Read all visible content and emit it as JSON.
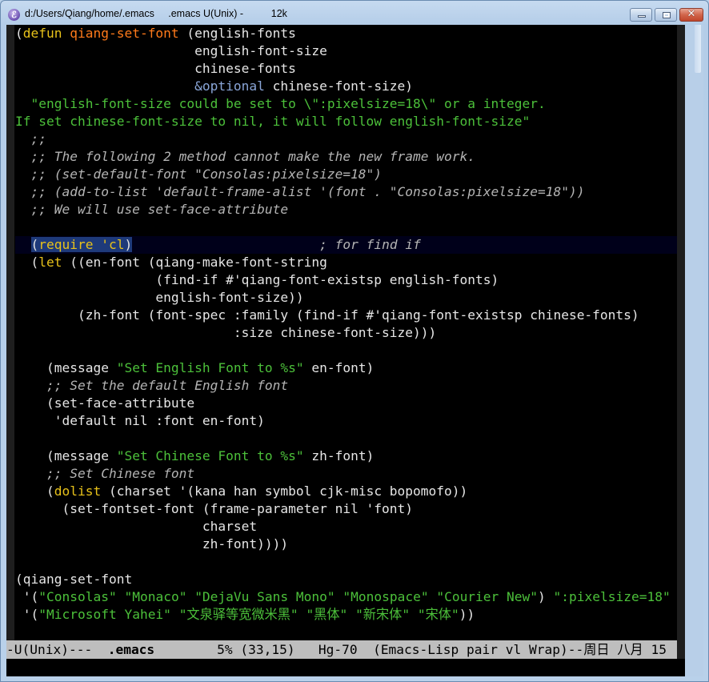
{
  "window": {
    "title_path": "d:/Users/Qiang/home/.emacs",
    "title_buffer": ".emacs U(Unix) -",
    "title_size": "12k",
    "icon": "emacs-icon",
    "caption_buttons": {
      "minimize": "minimize-icon",
      "maximize": "maximize-icon",
      "close": "close-icon",
      "close_glyph": "✕"
    }
  },
  "colors": {
    "keyword": "#e8c21a",
    "function_name": "#ff7a1a",
    "string": "#4cc03a",
    "comment": "#b4b4b4",
    "type": "#8aa6d8",
    "default_fg": "#e6e6e6",
    "background": "#000000",
    "region": "#1e3a7a",
    "modeline_bg": "#bebebe"
  },
  "buffer": {
    "lines": [
      [
        {
          "t": "(",
          "c": "paren"
        },
        {
          "t": "defun",
          "c": "kw"
        },
        {
          "t": " ",
          "c": "plain"
        },
        {
          "t": "qiang-set-font",
          "c": "fn"
        },
        {
          "t": " (english-fonts",
          "c": "plain"
        }
      ],
      [
        {
          "t": "                       english-font-size",
          "c": "plain"
        }
      ],
      [
        {
          "t": "                       chinese-fonts",
          "c": "plain"
        }
      ],
      [
        {
          "t": "                       ",
          "c": "plain"
        },
        {
          "t": "&optional",
          "c": "type"
        },
        {
          "t": " chinese-font-size)",
          "c": "plain"
        }
      ],
      [
        {
          "t": "  \"english-font-size could be set to \\\":pixelsize=18\\\" or a integer.",
          "c": "str"
        }
      ],
      [
        {
          "t": "If set chinese-font-size to nil, it will follow english-font-size\"",
          "c": "str"
        }
      ],
      [
        {
          "t": "  ;;",
          "c": "cm"
        }
      ],
      [
        {
          "t": "  ;; The following 2 method cannot make the new frame work.",
          "c": "cm"
        }
      ],
      [
        {
          "t": "  ;; (set-default-font \"Consolas:pixelsize=18\")",
          "c": "cm"
        }
      ],
      [
        {
          "t": "  ;; (add-to-list 'default-frame-alist '(font . \"Consolas:pixelsize=18\"))",
          "c": "cm"
        }
      ],
      [
        {
          "t": "  ;; We will use set-face-attribute",
          "c": "cm"
        }
      ],
      [],
      [
        {
          "t": "  ",
          "c": "plain"
        },
        {
          "t": "(",
          "c": "paren",
          "r": 1
        },
        {
          "t": "require",
          "c": "kw",
          "r": 1
        },
        {
          "t": " 'cl",
          "c": "kw",
          "r": 1
        },
        {
          "t": ")",
          "c": "paren",
          "r": 1
        },
        {
          "t": " ",
          "c": "cursor"
        },
        {
          "t": "                       ",
          "c": "plain"
        },
        {
          "t": "; for find if",
          "c": "cm"
        }
      ],
      [
        {
          "t": "  (",
          "c": "plain"
        },
        {
          "t": "let",
          "c": "kw"
        },
        {
          "t": " ((en-font (qiang-make-font-string",
          "c": "plain"
        }
      ],
      [
        {
          "t": "                  (find-if #'qiang-font-existsp english-fonts)",
          "c": "plain"
        }
      ],
      [
        {
          "t": "                  english-font-size))",
          "c": "plain"
        }
      ],
      [
        {
          "t": "        (zh-font (font-spec :family (find-if #'qiang-font-existsp chinese-fonts)",
          "c": "plain"
        }
      ],
      [
        {
          "t": "                            :size chinese-font-size)))",
          "c": "plain"
        }
      ],
      [],
      [
        {
          "t": "    (message ",
          "c": "plain"
        },
        {
          "t": "\"Set English Font to %s\"",
          "c": "str"
        },
        {
          "t": " en-font)",
          "c": "plain"
        }
      ],
      [
        {
          "t": "    ;; Set the default English font",
          "c": "cm"
        }
      ],
      [
        {
          "t": "    (set-face-attribute",
          "c": "plain"
        }
      ],
      [
        {
          "t": "     'default nil :font en-font)",
          "c": "plain"
        }
      ],
      [],
      [
        {
          "t": "    (message ",
          "c": "plain"
        },
        {
          "t": "\"Set Chinese Font to %s\"",
          "c": "str"
        },
        {
          "t": " zh-font)",
          "c": "plain"
        }
      ],
      [
        {
          "t": "    ;; Set Chinese font",
          "c": "cm"
        }
      ],
      [
        {
          "t": "    (",
          "c": "plain"
        },
        {
          "t": "dolist",
          "c": "kw"
        },
        {
          "t": " (charset '(kana han symbol cjk-misc bopomofo))",
          "c": "plain"
        }
      ],
      [
        {
          "t": "      (set-fontset-font (frame-parameter nil 'font)",
          "c": "plain"
        }
      ],
      [
        {
          "t": "                        charset",
          "c": "plain"
        }
      ],
      [
        {
          "t": "                        zh-font))))",
          "c": "plain"
        }
      ],
      [],
      [
        {
          "t": "(qiang-set-font",
          "c": "plain"
        }
      ],
      [
        {
          "t": " '(",
          "c": "plain"
        },
        {
          "t": "\"Consolas\"",
          "c": "str"
        },
        {
          "t": " ",
          "c": "plain"
        },
        {
          "t": "\"Monaco\"",
          "c": "str"
        },
        {
          "t": " ",
          "c": "plain"
        },
        {
          "t": "\"DejaVu Sans Mono\"",
          "c": "str"
        },
        {
          "t": " ",
          "c": "plain"
        },
        {
          "t": "\"Monospace\"",
          "c": "str"
        },
        {
          "t": " ",
          "c": "plain"
        },
        {
          "t": "\"Courier New\"",
          "c": "str"
        },
        {
          "t": ") ",
          "c": "plain"
        },
        {
          "t": "\":pixelsize=18\"",
          "c": "str"
        }
      ],
      [
        {
          "t": " '(",
          "c": "plain"
        },
        {
          "t": "\"Microsoft Yahei\"",
          "c": "str"
        },
        {
          "t": " ",
          "c": "plain"
        },
        {
          "t": "\"文泉驿等宽微米黑\"",
          "c": "str"
        },
        {
          "t": " ",
          "c": "plain"
        },
        {
          "t": "\"黑体\"",
          "c": "str"
        },
        {
          "t": " ",
          "c": "plain"
        },
        {
          "t": "\"新宋体\"",
          "c": "str"
        },
        {
          "t": " ",
          "c": "plain"
        },
        {
          "t": "\"宋体\"",
          "c": "str"
        },
        {
          "t": "))",
          "c": "plain"
        }
      ]
    ],
    "current_line_index": 12
  },
  "modeline": {
    "status": "-U(Unix)---  ",
    "buffer_name": ".emacs",
    "position": "        5% (33,15)   Hg-70  (Emacs-Lisp pair vl Wrap)--周日 八月 15"
  },
  "scrollbar": {
    "position_fraction": 0.05
  }
}
